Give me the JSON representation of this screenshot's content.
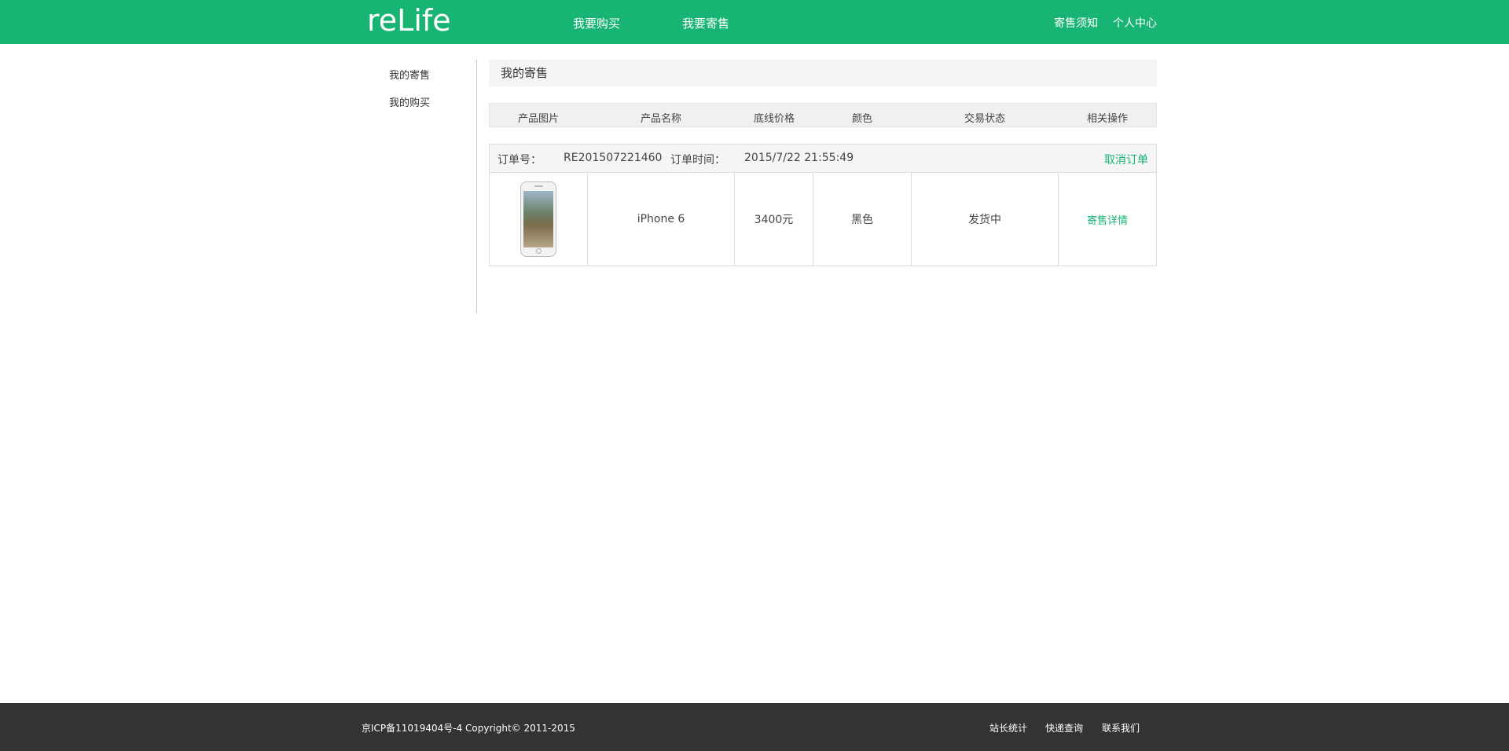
{
  "header": {
    "logo": "reLife",
    "nav": {
      "buy": "我要购买",
      "sell": "我要寄售"
    },
    "right": {
      "notice": "寄售须知",
      "center": "个人中心"
    },
    "brand_color": "#17b474"
  },
  "sidebar": {
    "items": [
      {
        "label": "我的寄售"
      },
      {
        "label": "我的购买"
      }
    ]
  },
  "main": {
    "title": "我的寄售",
    "columns": [
      "产品图片",
      "产品名称",
      "底线价格",
      "颜色",
      "交易状态",
      "相关操作"
    ],
    "order": {
      "order_no_label": "订单号：",
      "order_no": "RE201507221460",
      "time_label": "订单时间：",
      "time": "2015/7/22 21:55:49",
      "cancel_label": "取消订单",
      "item": {
        "image_icon": "iphone-image",
        "name": "iPhone 6",
        "price": "3400元",
        "color": "黑色",
        "status": "发货中",
        "action": "寄售详情"
      }
    }
  },
  "footer": {
    "copyright": "京ICP备11019404号-4 Copyright© 2011-2015",
    "links": [
      "站长统计",
      "快递查询",
      "联系我们"
    ]
  }
}
